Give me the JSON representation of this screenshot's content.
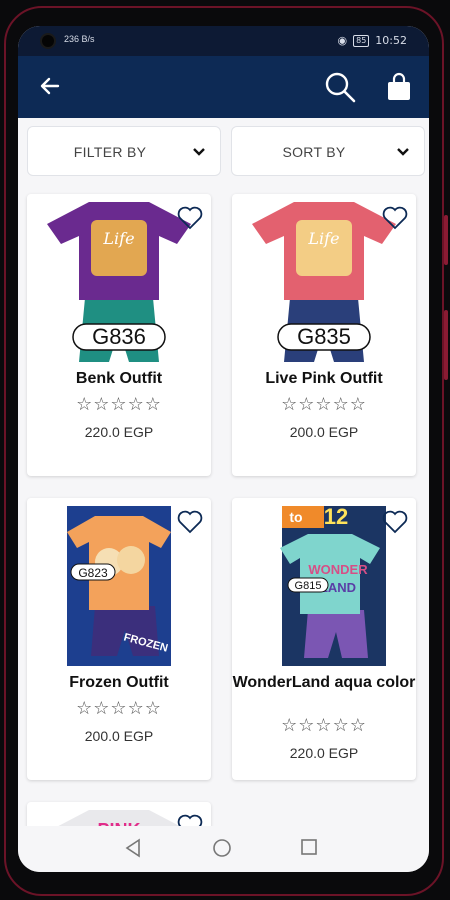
{
  "status_bar": {
    "left_icons": "236 B/s",
    "time": "10:52",
    "battery": "85"
  },
  "app_bar": {
    "back_icon": "arrow-left-icon",
    "search_icon": "search-icon",
    "cart_icon": "shopping-bag-icon"
  },
  "filter": {
    "label": "FILTER BY",
    "icon": "chevron-down-icon"
  },
  "sort": {
    "label": "SORT BY",
    "icon": "chevron-down-icon"
  },
  "products": [
    {
      "name": "Benk Outfit",
      "code": "G836",
      "rating": 0,
      "price": "220.0 EGP",
      "shirt_color": "#6a2a8f",
      "pants_color": "#1f8f82"
    },
    {
      "name": "Live Pink Outfit",
      "code": "G835",
      "rating": 0,
      "price": "200.0 EGP",
      "shirt_color": "#e3616f",
      "pants_color": "#2a3f7a"
    },
    {
      "name": "Frozen Outfit",
      "code": "G823",
      "rating": 0,
      "price": "200.0 EGP",
      "shirt_color": "#f3a25b",
      "pants_color": "#3b2f7c"
    },
    {
      "name": "WonderLand aqua color",
      "code": "G815",
      "rating": 0,
      "price": "220.0 EGP",
      "shirt_color": "#7fd5cd",
      "pants_color": "#7b56b3"
    }
  ],
  "partial_product": {
    "code": "PINK",
    "shirt_color": "#e9e9ec"
  },
  "colors": {
    "app_bar": "#0d2a55",
    "status_bar": "#0d1a34",
    "background": "#f6f6f8"
  }
}
